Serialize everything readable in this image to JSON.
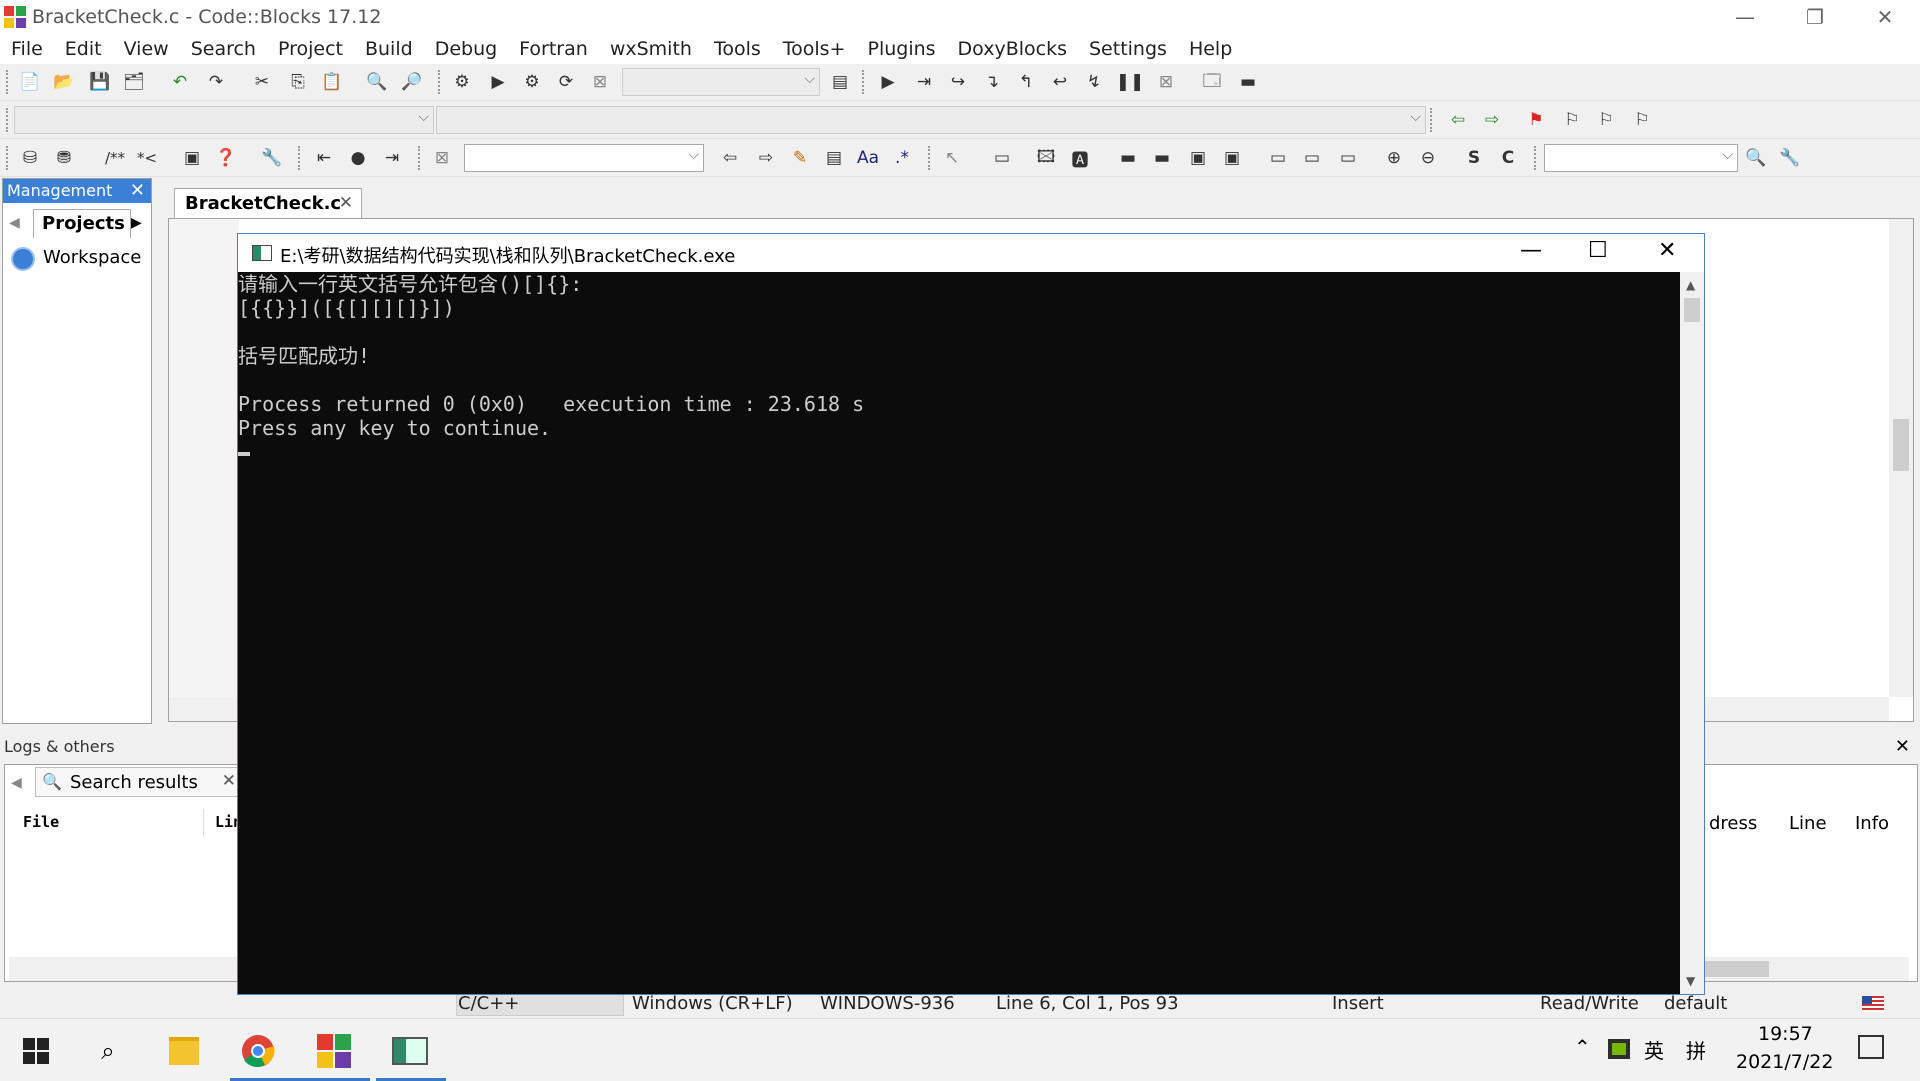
{
  "window": {
    "title": "BracketCheck.c - Code::Blocks 17.12"
  },
  "menu": [
    "File",
    "Edit",
    "View",
    "Search",
    "Project",
    "Build",
    "Debug",
    "Fortran",
    "wxSmith",
    "Tools",
    "Tools+",
    "Plugins",
    "DoxyBlocks",
    "Settings",
    "Help"
  ],
  "toolbar": {
    "doc_comment": "/**",
    "line_comment": "*<"
  },
  "management": {
    "title": "Management",
    "tab": "Projects",
    "workspace": "Workspace"
  },
  "editor": {
    "tab": "BracketCheck.c"
  },
  "console": {
    "title": "E:\\考研\\数据结构代码实现\\栈和队列\\BracketCheck.exe",
    "lines": [
      "请输入一行英文括号允许包含()[]{}:",
      "[{{}}]([{[][][]}])",
      "",
      "括号匹配成功!",
      "",
      "Process returned 0 (0x0)   execution time : 23.618 s",
      "Press any key to continue."
    ]
  },
  "logs": {
    "title": "Logs & others",
    "tab": "Search results",
    "col_file": "File",
    "col_line": "Lin",
    "right_cols": [
      "dress",
      "Line",
      "Info"
    ]
  },
  "status": {
    "language": "C/C++",
    "eol": "Windows (CR+LF)",
    "encoding": "WINDOWS-936",
    "position": "Line 6, Col 1, Pos 93",
    "mode": "Insert",
    "access": "Read/Write",
    "profile": "default"
  },
  "taskbar": {
    "ime1": "英",
    "ime2": "拼",
    "time": "19:57",
    "date": "2021/7/22"
  },
  "colors": {
    "accent": "#3c7fd6",
    "console_bg": "#0c0c0c",
    "console_fg": "#cccccc"
  }
}
